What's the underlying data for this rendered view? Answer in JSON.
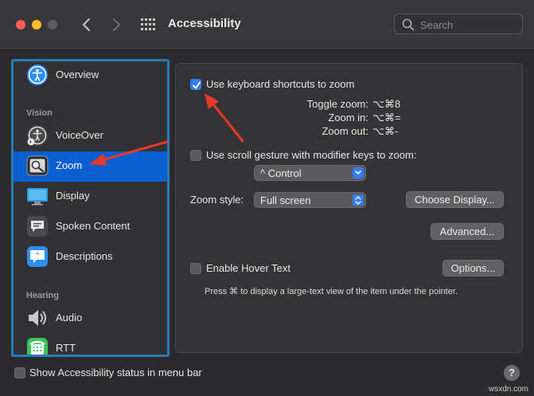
{
  "window": {
    "title": "Accessibility",
    "search_placeholder": "Search"
  },
  "sidebar": {
    "items": [
      {
        "label": "Overview",
        "icon": "accessibility-icon"
      },
      {
        "label": "VoiceOver",
        "icon": "voiceover-icon"
      },
      {
        "label": "Zoom",
        "icon": "zoom-icon",
        "selected": true
      },
      {
        "label": "Display",
        "icon": "display-icon"
      },
      {
        "label": "Spoken Content",
        "icon": "spoken-content-icon"
      },
      {
        "label": "Descriptions",
        "icon": "descriptions-icon"
      },
      {
        "label": "Audio",
        "icon": "audio-icon"
      },
      {
        "label": "RTT",
        "icon": "rtt-icon"
      }
    ],
    "sections": {
      "vision": "Vision",
      "hearing": "Hearing"
    }
  },
  "zoom": {
    "keyboard_shortcuts_label": "Use keyboard shortcuts to zoom",
    "keyboard_shortcuts_checked": true,
    "shortcuts": [
      {
        "label": "Toggle zoom:",
        "keys": "⌥⌘8"
      },
      {
        "label": "Zoom in:",
        "keys": "⌥⌘="
      },
      {
        "label": "Zoom out:",
        "keys": "⌥⌘-"
      }
    ],
    "scroll_gesture_label": "Use scroll gesture with modifier keys to zoom:",
    "scroll_gesture_checked": false,
    "modifier_value": "^ Control",
    "zoom_style_label": "Zoom style:",
    "zoom_style_value": "Full screen",
    "choose_display_button": "Choose Display...",
    "advanced_button": "Advanced...",
    "hover_text_label": "Enable Hover Text",
    "hover_text_checked": false,
    "options_button": "Options...",
    "hover_note": "Press ⌘ to display a large-text view of the item under the pointer."
  },
  "footer": {
    "status_menu_label": "Show Accessibility status in menu bar",
    "status_menu_checked": false,
    "help_label": "?"
  },
  "watermark": "wsxdn.com",
  "colors": {
    "accent": "#2f7cf6",
    "selection": "#0a5fd0",
    "annotation_arrow": "#e53a2a"
  }
}
